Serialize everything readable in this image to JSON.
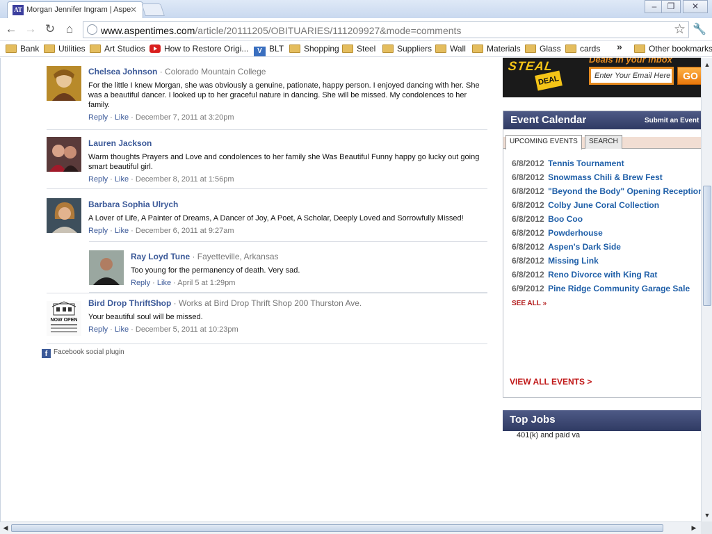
{
  "browser": {
    "tab_title": "Morgan Jennifer Ingram | Aspen",
    "favicon_text": "AT",
    "url_domain": "www.aspentimes.com",
    "url_path": "/article/20111205/OBITUARIES/111209927&mode=comments",
    "bookmarks": [
      {
        "label": "Bank",
        "icon": "folder-icon"
      },
      {
        "label": "Utilities",
        "icon": "folder-icon"
      },
      {
        "label": "Art Studios",
        "icon": "folder-icon"
      },
      {
        "label": "How to Restore Origi...",
        "icon": "youtube-icon"
      },
      {
        "label": "BLT",
        "icon": "v-icon"
      },
      {
        "label": "Shopping",
        "icon": "folder-icon"
      },
      {
        "label": "Steel",
        "icon": "folder-icon"
      },
      {
        "label": "Suppliers",
        "icon": "folder-icon"
      },
      {
        "label": "Wall",
        "icon": "folder-icon"
      },
      {
        "label": "Materials",
        "icon": "folder-icon"
      },
      {
        "label": "Glass",
        "icon": "folder-icon"
      },
      {
        "label": "cards",
        "icon": "folder-icon"
      }
    ],
    "overflow_chevron": "»",
    "other_bookmarks": "Other bookmarks"
  },
  "comments": [
    {
      "author": "Chelsea Johnson",
      "affiliation": "· Colorado Mountain College",
      "text": "For the little I knew Morgan, she was obviously a genuine, pationate, happy person. I enjoyed dancing with her. She was a beautiful dancer. I looked up to her graceful nature in dancing. She will be missed. My condolences to her family.",
      "reply": "Reply",
      "like": "Like",
      "timestamp": "December 7, 2011 at 3:20pm"
    },
    {
      "author": "Lauren Jackson",
      "affiliation": "",
      "text": "Warm thoughts Prayers and Love and condolences to her family she Was Beautiful Funny happy go lucky out going smart beautiful girl.",
      "reply": "Reply",
      "like": "Like",
      "timestamp": "December 8, 2011 at 1:56pm"
    },
    {
      "author": "Barbara Sophia Ulrych",
      "affiliation": "",
      "text": "A Lover of Life, A Painter of Dreams, A Dancer of Joy, A Poet, A Scholar, Deeply Loved and Sorrowfully Missed!",
      "reply": "Reply",
      "like": "Like",
      "timestamp": "December 6, 2011 at 9:27am"
    },
    {
      "author": "Ray Loyd Tune",
      "affiliation": "· Fayetteville, Arkansas",
      "text": "Too young for the permanency of death. Very sad.",
      "reply": "Reply",
      "like": "Like",
      "timestamp": "April 5 at 1:29pm"
    },
    {
      "author": "Bird Drop ThriftShop",
      "affiliation": "· Works at Bird Drop Thrift Shop 200 Thurston Ave.",
      "text": "Your beautiful soul will be missed.",
      "reply": "Reply",
      "like": "Like",
      "timestamp": "December 5, 2011 at 10:23pm"
    }
  ],
  "avatar_text": "NOW OPEN",
  "fb_plugin": "Facebook social plugin",
  "promo": {
    "logo": "STEAL",
    "logo_sub": "DEAL",
    "tagline": "Deals in your inbox",
    "email_placeholder": "Enter Your Email Here",
    "go": "GO"
  },
  "calendar": {
    "title": "Event Calendar",
    "submit": "Submit an Event",
    "tabs": [
      "UPCOMING EVENTS",
      "SEARCH"
    ],
    "events": [
      {
        "date": "6/8/2012",
        "name": "Tennis Tournament"
      },
      {
        "date": "6/8/2012",
        "name": "Snowmass Chili & Brew Fest"
      },
      {
        "date": "6/8/2012",
        "name": "\"Beyond the Body\" Opening Reception"
      },
      {
        "date": "6/8/2012",
        "name": "Colby June Coral Collection"
      },
      {
        "date": "6/8/2012",
        "name": "Boo Coo"
      },
      {
        "date": "6/8/2012",
        "name": "Powderhouse"
      },
      {
        "date": "6/8/2012",
        "name": "Aspen's Dark Side"
      },
      {
        "date": "6/8/2012",
        "name": "Missing Link"
      },
      {
        "date": "6/8/2012",
        "name": "Reno Divorce with King Rat"
      },
      {
        "date": "6/9/2012",
        "name": "Pine Ridge Community Garage Sale"
      }
    ],
    "see_all": "SEE ALL »",
    "view_all": "VIEW ALL EVENTS >"
  },
  "top_jobs": {
    "title": "Top Jobs",
    "line": "401(k) and paid va"
  },
  "colors": {
    "facebook_link": "#3b5998",
    "event_link": "#1f5fa8",
    "accent_red": "#c01818",
    "header_navy": "#2f3a63"
  }
}
